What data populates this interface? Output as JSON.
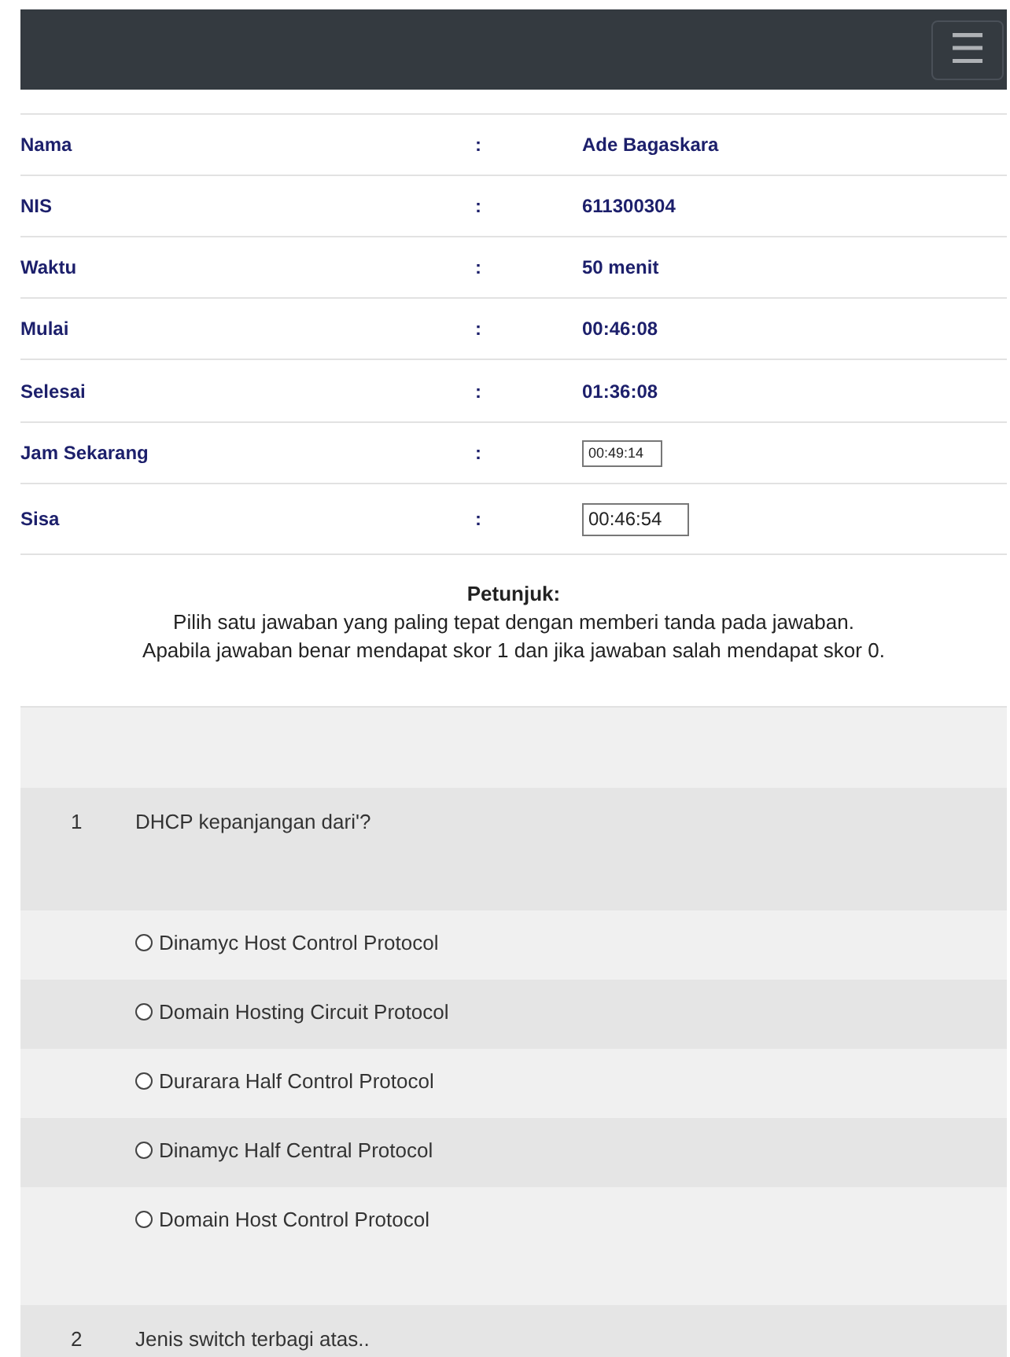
{
  "navbar": {
    "menu_button": "☰"
  },
  "info": [
    {
      "label": "Nama",
      "colon": ":",
      "kind": "text",
      "value": "Ade Bagaskara"
    },
    {
      "label": "NIS",
      "colon": ":",
      "kind": "text",
      "value": "611300304"
    },
    {
      "label": "Waktu",
      "colon": ":",
      "kind": "text",
      "value": "50 menit"
    },
    {
      "label": "Mulai",
      "colon": ":",
      "kind": "text",
      "value": "00:46:08"
    },
    {
      "label": "Selesai",
      "colon": ":",
      "kind": "text",
      "value": "01:36:08"
    },
    {
      "label": "Jam Sekarang",
      "colon": ":",
      "kind": "small_input",
      "value": "00:49:14"
    },
    {
      "label": "Sisa",
      "colon": ":",
      "kind": "input",
      "value": "00:46:54"
    }
  ],
  "instructions": {
    "title": "Petunjuk:",
    "lines": [
      "Pilih satu jawaban yang paling tepat dengan memberi tanda pada jawaban.",
      "Apabila jawaban benar mendapat skor 1 dan jika jawaban salah mendapat skor 0."
    ]
  },
  "questions": [
    {
      "number": "1",
      "text": "DHCP kepanjangan dari'?",
      "options": [
        {
          "label": "Dinamyc Host Control Protocol",
          "selected": false
        },
        {
          "label": "Domain Hosting Circuit Protocol",
          "selected": false
        },
        {
          "label": "Durarara Half Control Protocol",
          "selected": false
        },
        {
          "label": "Dinamyc Half Central Protocol",
          "selected": false
        },
        {
          "label": "Domain Host Control Protocol",
          "selected": false
        }
      ]
    },
    {
      "number": "2",
      "text": "Jenis switch terbagi atas.."
    }
  ]
}
